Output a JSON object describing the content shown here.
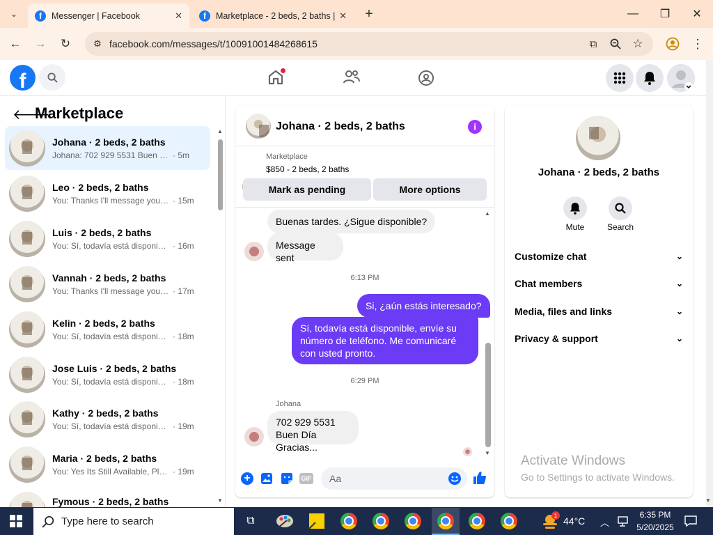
{
  "browser": {
    "tabs": [
      {
        "title": "Messenger | Facebook",
        "active": true
      },
      {
        "title": "Marketplace - 2 beds, 2 baths |",
        "active": false
      }
    ],
    "url": "facebook.com/messages/t/10091001484268615"
  },
  "left": {
    "title": "Marketplace",
    "conversations": [
      {
        "name": "Johana · 2 beds, 2 baths",
        "preview": "Johana: 702 929 5531 Buen Día Gr...",
        "time": "· 5m",
        "active": true
      },
      {
        "name": "Leo · 2 beds, 2 baths",
        "preview": "You: Thanks I'll message you in a ...",
        "time": "· 15m"
      },
      {
        "name": "Luis · 2 beds, 2 baths",
        "preview": "You: Sí, todavía está disponible, e...",
        "time": "· 16m"
      },
      {
        "name": "Vannah · 2 beds, 2 baths",
        "preview": "You: Thanks I'll message you in a ...",
        "time": "· 17m"
      },
      {
        "name": "Kelin · 2 beds, 2 baths",
        "preview": "You: Sí, todavía está disponible, e...",
        "time": "· 18m"
      },
      {
        "name": "Jose Luis · 2 beds, 2 baths",
        "preview": "You: Sí, todavía está disponible, e...",
        "time": "· 18m"
      },
      {
        "name": "Kathy · 2 beds, 2 baths",
        "preview": "You: Sí, todavía está disponible, e...",
        "time": "· 19m"
      },
      {
        "name": "Maria · 2 beds, 2 baths",
        "preview": "You: Yes Its Still Available, Please ...",
        "time": "· 19m"
      },
      {
        "name": "Fymous · 2 beds, 2 baths",
        "preview": "",
        "time": ""
      }
    ]
  },
  "chat": {
    "title": "Johana · 2 beds, 2 baths",
    "listing": {
      "source": "Marketplace",
      "price_title": "$850 - 2 beds, 2 baths"
    },
    "mark_pending": "Mark as pending",
    "more_options": "More options",
    "messages": {
      "m1": "Buenas tardes. ¿Sigue disponible?",
      "m2": "Message sent",
      "t1": "6:13 PM",
      "m3": "Si, ¿aún estás interesado?",
      "m4": "Sí, todavía está disponible, envíe su número de teléfono. Me comunicaré con usted pronto.",
      "t2": "6:29 PM",
      "sender": "Johana",
      "m5": "702 929 5531",
      "m6": "Buen Día Gracias..."
    },
    "composer_placeholder": "Aa",
    "gif_label": "GIF"
  },
  "right": {
    "name": "Johana · 2 beds, 2 baths",
    "mute": "Mute",
    "search": "Search",
    "sections": [
      "Customize chat",
      "Chat members",
      "Media, files and links",
      "Privacy & support"
    ]
  },
  "watermark": {
    "title": "Activate Windows",
    "subtitle": "Go to Settings to activate Windows."
  },
  "taskbar": {
    "search": "Type here to search",
    "weather": "44°C",
    "time": "6:35 PM",
    "date": "5/20/2025",
    "badge": "1"
  },
  "colors": {
    "facebook_blue": "#1877f2",
    "bubble_out": "#6b3bf5",
    "info_purple": "#a033ff"
  }
}
